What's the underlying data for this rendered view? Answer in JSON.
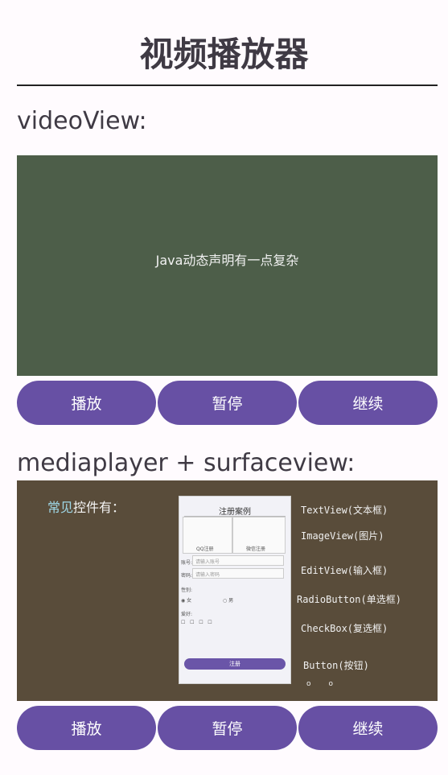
{
  "header": {
    "title": "视频播放器"
  },
  "section1": {
    "label": "videoView:",
    "video_caption": "Java动态声明有一点复杂",
    "buttons": {
      "play": "播放",
      "pause": "暂停",
      "resume": "继续"
    }
  },
  "section2": {
    "label": "mediaplayer + surfaceview:",
    "frame": {
      "heading_accent": "常见",
      "heading_rest": "控件有：",
      "phone_title": "注册案例",
      "qq_label": "QQ注册",
      "wechat_label": "微信注册",
      "account_label": "账号:",
      "account_placeholder": "请输入账号",
      "password_label": "密码:",
      "password_placeholder": "请输入密码",
      "gender_label": "性别:",
      "gender_female": "女",
      "gender_male": "男",
      "hobby_label": "爱好:",
      "register_button": "注册",
      "annotations": [
        "TextView(文本框)",
        "ImageView(图片)",
        "EditView(输入框)",
        "RadioButton(单选框)",
        "CheckBox(复选框)",
        "Button(按钮)"
      ]
    },
    "buttons": {
      "play": "播放",
      "pause": "暂停",
      "resume": "继续"
    }
  },
  "colors": {
    "accent": "#6750a4",
    "video1_bg": "#4d5e49",
    "video2_bg": "#594c3a",
    "background": "#fffbfe"
  }
}
